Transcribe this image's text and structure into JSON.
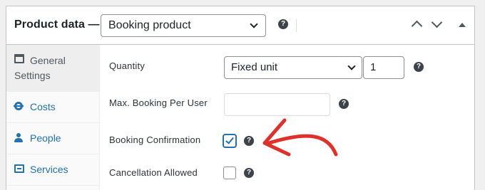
{
  "header": {
    "title": "Product data —",
    "product_type": "Booking product",
    "help_glyph": "?"
  },
  "tabs": [
    {
      "label": "General Settings",
      "icon": "settings-window-icon",
      "active": true
    },
    {
      "label": "Costs",
      "icon": "gear-icon",
      "active": false
    },
    {
      "label": "People",
      "icon": "person-icon",
      "active": false
    },
    {
      "label": "Services",
      "icon": "services-icon",
      "active": false
    }
  ],
  "fields": {
    "quantity": {
      "label": "Quantity",
      "unit": "Fixed unit",
      "value": "1"
    },
    "max_booking": {
      "label": "Max. Booking Per User",
      "value": ""
    },
    "confirmation": {
      "label": "Booking Confirmation",
      "checked": true
    },
    "cancellation": {
      "label": "Cancellation Allowed",
      "checked": false
    }
  },
  "colors": {
    "accent": "#2271b1",
    "annotation_arrow": "#e0302a"
  }
}
